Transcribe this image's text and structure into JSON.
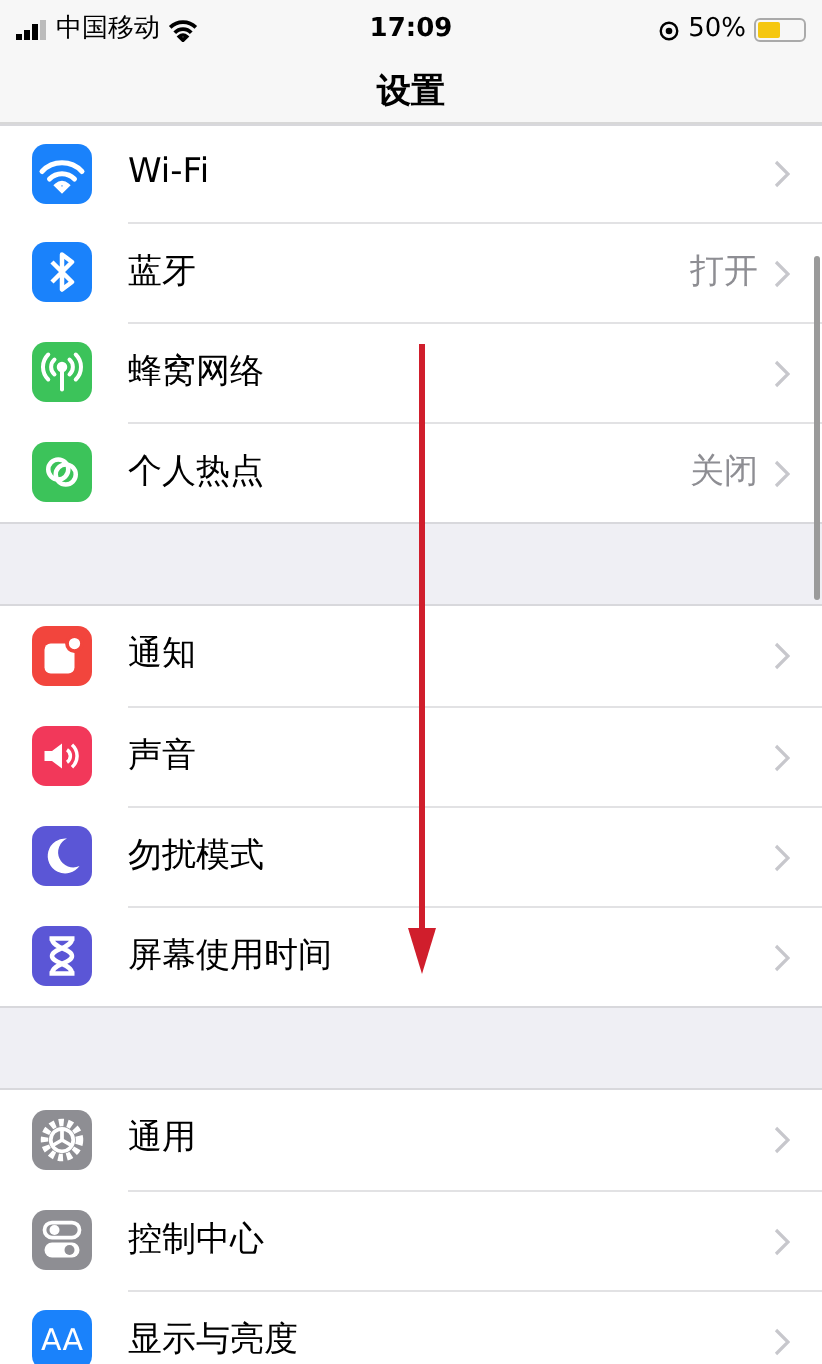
{
  "status_bar": {
    "carrier": "中国移动",
    "time": "17:09",
    "battery": "50%",
    "level": 0.5
  },
  "title": "设置",
  "groups": [
    {
      "items": [
        {
          "kind": "wifi",
          "label": "Wi-Fi"
        },
        {
          "kind": "bluetooth",
          "label": "蓝牙",
          "value": "打开"
        },
        {
          "kind": "cellular",
          "label": "蜂窝网络"
        },
        {
          "kind": "hotspot",
          "label": "个人热点",
          "value": "关闭"
        }
      ]
    },
    {
      "items": [
        {
          "kind": "notifications",
          "label": "通知"
        },
        {
          "kind": "sound",
          "label": "声音"
        },
        {
          "kind": "moon",
          "label": "勿扰模式"
        },
        {
          "kind": "hourglass",
          "label": "屏幕使用时间"
        }
      ]
    },
    {
      "items": [
        {
          "kind": "gear",
          "label": "通用"
        },
        {
          "kind": "toggles",
          "label": "控制中心"
        },
        {
          "kind": "text",
          "label": "显示与亮度",
          "glyph": "AA"
        }
      ]
    }
  ]
}
